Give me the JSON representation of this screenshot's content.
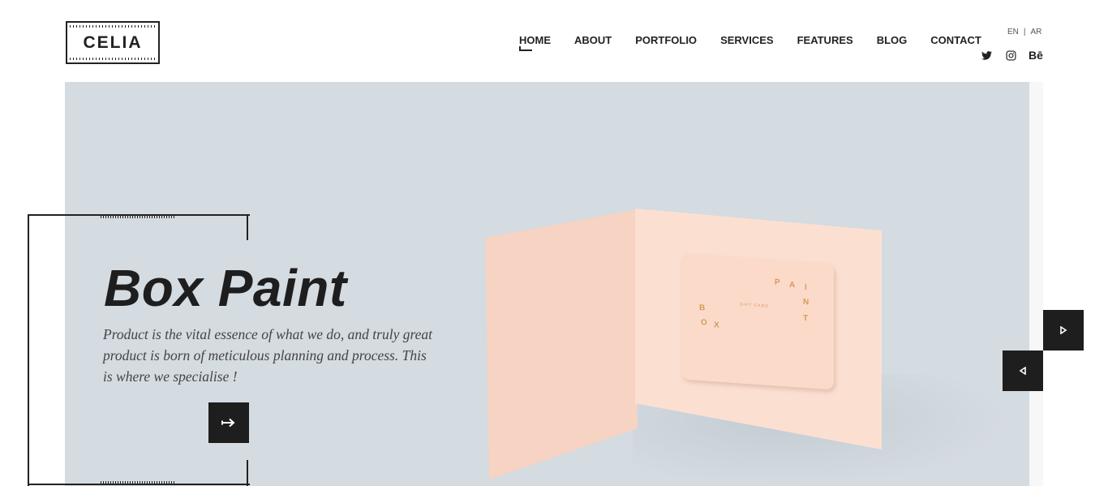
{
  "header": {
    "logo": "CELIA",
    "nav": [
      {
        "label": "HOME",
        "active": true
      },
      {
        "label": "ABOUT"
      },
      {
        "label": "PORTFOLIO"
      },
      {
        "label": "SERVICES"
      },
      {
        "label": "FEATURES"
      },
      {
        "label": "BLOG"
      },
      {
        "label": "CONTACT"
      }
    ],
    "lang": {
      "en": "EN",
      "sep": "|",
      "ar": "AR"
    },
    "social": [
      {
        "icon": "twitter-icon"
      },
      {
        "icon": "instagram-icon"
      },
      {
        "icon": "behance-icon",
        "label": "Bē"
      }
    ]
  },
  "hero": {
    "title": "Box Paint",
    "description": "Product is the vital essence of what we do, and truly great product is born of meticulous planning and process. This is where we specialise !",
    "cta_icon": "arrow-right-icon",
    "next_icon": "play-right-icon",
    "prev_icon": "play-left-icon",
    "colors": {
      "background": "#d4dbe1",
      "card": "#fbe0d2",
      "dark": "#1e1e1e",
      "accent": "#d59a5b"
    },
    "giftcard": {
      "p": "P",
      "a": "A",
      "i": "I",
      "n": "N",
      "t": "T",
      "b": "B",
      "o": "O",
      "x": "X",
      "caption": "GIFT CARD"
    }
  }
}
